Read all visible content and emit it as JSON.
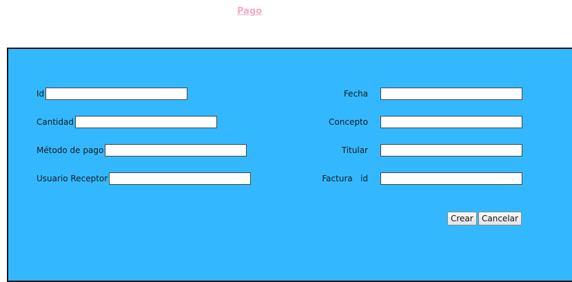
{
  "header": {
    "title_link": "Pago"
  },
  "form": {
    "left": [
      {
        "label": "Id",
        "value": ""
      },
      {
        "label": "Cantidad",
        "value": ""
      },
      {
        "label": "Método de pago",
        "value": ""
      },
      {
        "label": "Usuario Receptor",
        "value": ""
      }
    ],
    "right": [
      {
        "label": "Fecha",
        "value": ""
      },
      {
        "label": "Concepto",
        "value": ""
      },
      {
        "label": "Titular",
        "value": ""
      },
      {
        "label": "Factura   id",
        "value": ""
      }
    ]
  },
  "buttons": {
    "create": "Crear",
    "cancel": "Cancelar"
  },
  "colors": {
    "panel_bg": "#33b8ff",
    "link": "#f7a8c6"
  }
}
